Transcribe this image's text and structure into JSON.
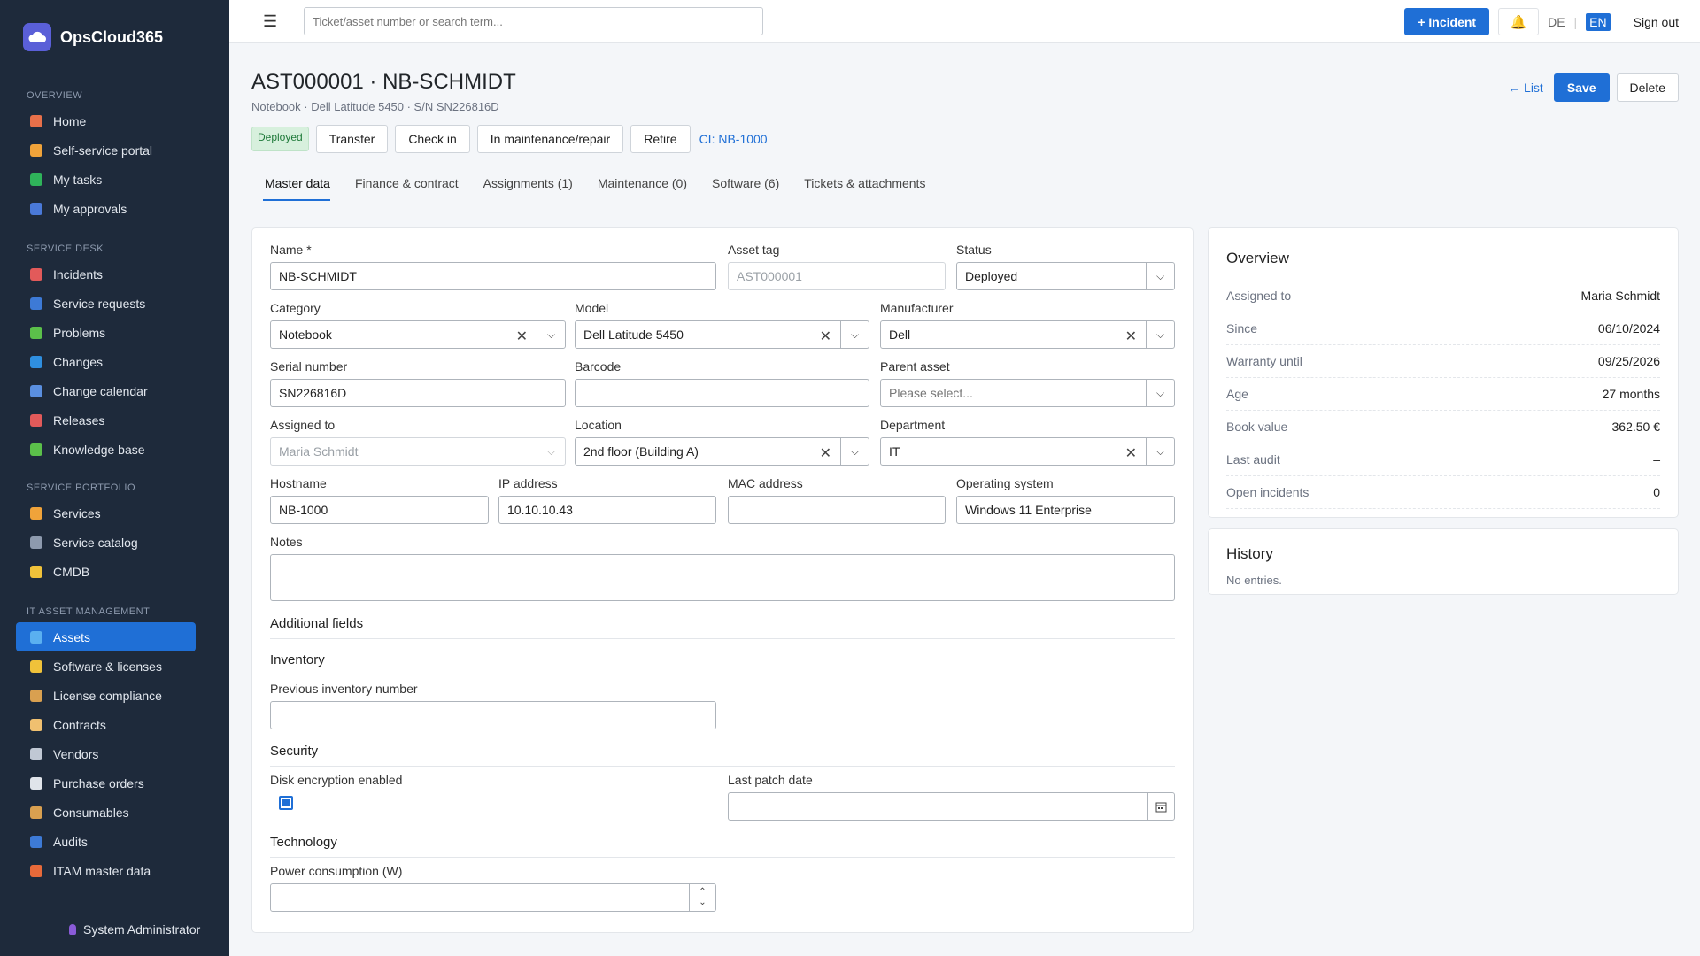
{
  "app": {
    "name": "OpsCloud365"
  },
  "sidebar": {
    "sections": [
      {
        "title": "OVERVIEW",
        "items": [
          {
            "label": "Home",
            "icon": "home-icon",
            "color": "#e8704a"
          },
          {
            "label": "Self-service portal",
            "icon": "user-icon",
            "color": "#f0a33a"
          },
          {
            "label": "My tasks",
            "icon": "checkbox-icon",
            "color": "#2fb35a"
          },
          {
            "label": "My approvals",
            "icon": "check-icon",
            "color": "#4a79d8"
          }
        ]
      },
      {
        "title": "SERVICE DESK",
        "items": [
          {
            "label": "Incidents",
            "icon": "clipboard-icon",
            "color": "#e25a5a"
          },
          {
            "label": "Service requests",
            "icon": "inbox-icon",
            "color": "#3d7ad6"
          },
          {
            "label": "Problems",
            "icon": "puzzle-icon",
            "color": "#5bc04a"
          },
          {
            "label": "Changes",
            "icon": "refresh-icon",
            "color": "#2f8fe0"
          },
          {
            "label": "Change calendar",
            "icon": "calendar-icon",
            "color": "#5a8fe0"
          },
          {
            "label": "Releases",
            "icon": "rocket-icon",
            "color": "#e25a5a"
          },
          {
            "label": "Knowledge base",
            "icon": "books-icon",
            "color": "#5bc04a"
          }
        ]
      },
      {
        "title": "SERVICE PORTFOLIO",
        "items": [
          {
            "label": "Services",
            "icon": "bell-service-icon",
            "color": "#f0a33a"
          },
          {
            "label": "Service catalog",
            "icon": "catalog-icon",
            "color": "#8d9aae"
          },
          {
            "label": "CMDB",
            "icon": "folder-icon",
            "color": "#f0c23a"
          }
        ]
      },
      {
        "title": "IT ASSET MANAGEMENT",
        "items": [
          {
            "label": "Assets",
            "icon": "laptop-icon",
            "color": "#5ab0f0",
            "active": true
          },
          {
            "label": "Software & licenses",
            "icon": "disc-icon",
            "color": "#f0c23a"
          },
          {
            "label": "License compliance",
            "icon": "scales-icon",
            "color": "#d9a050"
          },
          {
            "label": "Contracts",
            "icon": "scroll-icon",
            "color": "#f0c070"
          },
          {
            "label": "Vendors",
            "icon": "building-icon",
            "color": "#c0c8d4"
          },
          {
            "label": "Purchase orders",
            "icon": "receipt-icon",
            "color": "#e0e4ea"
          },
          {
            "label": "Consumables",
            "icon": "box-icon",
            "color": "#d9a050"
          },
          {
            "label": "Audits",
            "icon": "magnifier-icon",
            "color": "#3d7ad6"
          },
          {
            "label": "ITAM master data",
            "icon": "bricks-icon",
            "color": "#e86a3a"
          }
        ]
      }
    ],
    "user": "System Administrator"
  },
  "topbar": {
    "search_placeholder": "Ticket/asset number or search term...",
    "incident_button": "+ Incident",
    "lang_de": "DE",
    "lang_en": "EN",
    "signout": "Sign out"
  },
  "asset": {
    "title": "AST000001 · NB-SCHMIDT",
    "subtitle": "Notebook · Dell Latitude 5450 · S/N SN226816D",
    "status_badge": "Deployed",
    "actions": [
      "Transfer",
      "Check in",
      "In maintenance/repair",
      "Retire"
    ],
    "ci_link": "CI: NB-1000",
    "list_link": "← List",
    "save": "Save",
    "delete": "Delete"
  },
  "tabs": [
    "Master data",
    "Finance & contract",
    "Assignments (1)",
    "Maintenance (0)",
    "Software (6)",
    "Tickets & attachments"
  ],
  "form": {
    "name_label": "Name *",
    "name_value": "NB-SCHMIDT",
    "asset_tag_label": "Asset tag",
    "asset_tag_value": "AST000001",
    "status_label": "Status",
    "status_value": "Deployed",
    "category_label": "Category",
    "category_value": "Notebook",
    "model_label": "Model",
    "model_value": "Dell Latitude 5450",
    "manufacturer_label": "Manufacturer",
    "manufacturer_value": "Dell",
    "serial_label": "Serial number",
    "serial_value": "SN226816D",
    "barcode_label": "Barcode",
    "barcode_value": "",
    "parent_label": "Parent asset",
    "parent_placeholder": "Please select...",
    "assigned_label": "Assigned to",
    "assigned_value": "Maria Schmidt",
    "location_label": "Location",
    "location_value": "2nd floor (Building A)",
    "department_label": "Department",
    "department_value": "IT",
    "hostname_label": "Hostname",
    "hostname_value": "NB-1000",
    "ip_label": "IP address",
    "ip_value": "10.10.10.43",
    "mac_label": "MAC address",
    "mac_value": "",
    "os_label": "Operating system",
    "os_value": "Windows 11 Enterprise",
    "notes_label": "Notes",
    "additional_title": "Additional fields",
    "inventory_title": "Inventory",
    "prev_inv_label": "Previous inventory number",
    "security_title": "Security",
    "disk_enc_label": "Disk encryption enabled",
    "last_patch_label": "Last patch date",
    "technology_title": "Technology",
    "power_label": "Power consumption (W)"
  },
  "overview": {
    "title": "Overview",
    "rows": [
      {
        "k": "Assigned to",
        "v": "Maria Schmidt"
      },
      {
        "k": "Since",
        "v": "06/10/2024"
      },
      {
        "k": "Warranty until",
        "v": "09/25/2026"
      },
      {
        "k": "Age",
        "v": "27 months"
      },
      {
        "k": "Book value",
        "v": "362.50 €"
      },
      {
        "k": "Last audit",
        "v": "–"
      },
      {
        "k": "Open incidents",
        "v": "0"
      }
    ]
  },
  "history": {
    "title": "History",
    "empty": "No entries."
  }
}
